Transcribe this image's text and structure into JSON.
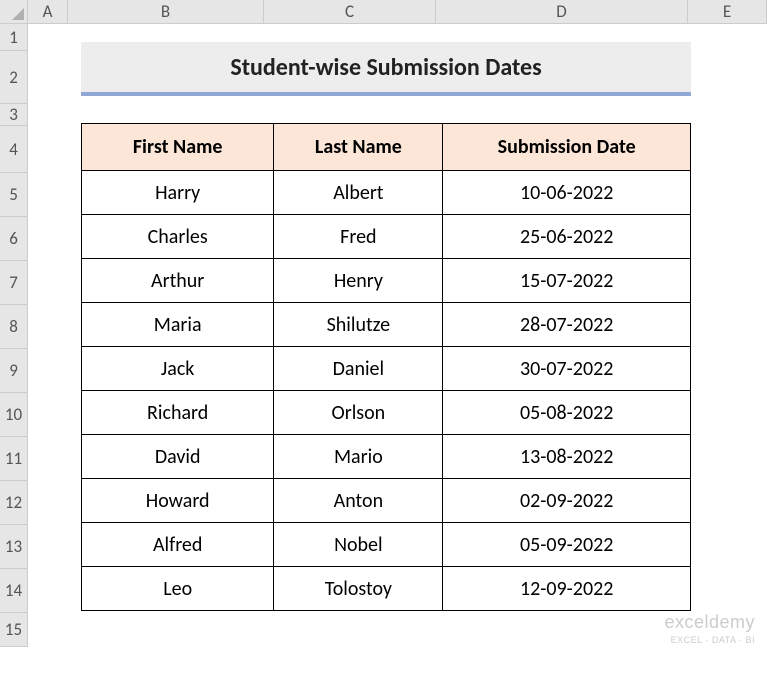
{
  "columns": [
    "A",
    "B",
    "C",
    "D",
    "E"
  ],
  "rows_visible": [
    "1",
    "2",
    "3",
    "4",
    "5",
    "6",
    "7",
    "8",
    "9",
    "10",
    "11",
    "12",
    "13",
    "14",
    "15"
  ],
  "title": "Student-wise Submission Dates",
  "headers": {
    "first": "First Name",
    "last": "Last Name",
    "date": "Submission Date"
  },
  "data": [
    {
      "first": "Harry",
      "last": "Albert",
      "date": "10-06-2022"
    },
    {
      "first": "Charles",
      "last": "Fred",
      "date": "25-06-2022"
    },
    {
      "first": "Arthur",
      "last": "Henry",
      "date": "15-07-2022"
    },
    {
      "first": "Maria",
      "last": "Shilutze",
      "date": "28-07-2022"
    },
    {
      "first": "Jack",
      "last": "Daniel",
      "date": "30-07-2022"
    },
    {
      "first": "Richard",
      "last": "Orlson",
      "date": "05-08-2022"
    },
    {
      "first": "David",
      "last": "Mario",
      "date": "13-08-2022"
    },
    {
      "first": "Howard",
      "last": "Anton",
      "date": "02-09-2022"
    },
    {
      "first": "Alfred",
      "last": "Nobel",
      "date": "05-09-2022"
    },
    {
      "first": "Leo",
      "last": "Tolostoy",
      "date": "12-09-2022"
    }
  ],
  "watermark": {
    "line1": "exceldemy",
    "line2": "EXCEL · DATA · BI"
  },
  "chart_data": {
    "type": "table",
    "title": "Student-wise Submission Dates",
    "columns": [
      "First Name",
      "Last Name",
      "Submission Date"
    ],
    "rows": [
      [
        "Harry",
        "Albert",
        "10-06-2022"
      ],
      [
        "Charles",
        "Fred",
        "25-06-2022"
      ],
      [
        "Arthur",
        "Henry",
        "15-07-2022"
      ],
      [
        "Maria",
        "Shilutze",
        "28-07-2022"
      ],
      [
        "Jack",
        "Daniel",
        "30-07-2022"
      ],
      [
        "Richard",
        "Orlson",
        "05-08-2022"
      ],
      [
        "David",
        "Mario",
        "13-08-2022"
      ],
      [
        "Howard",
        "Anton",
        "02-09-2022"
      ],
      [
        "Alfred",
        "Nobel",
        "05-09-2022"
      ],
      [
        "Leo",
        "Tolostoy",
        "12-09-2022"
      ]
    ]
  }
}
